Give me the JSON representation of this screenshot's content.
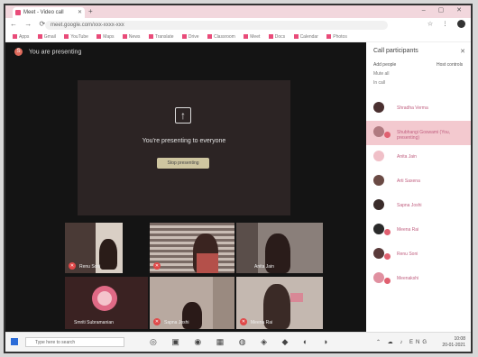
{
  "browser": {
    "tab_title": "Meet - Video call",
    "new_tab": "+",
    "window_controls": "– ▢ ✕",
    "url": "meet.google.com/xxx-xxxx-xxx",
    "nav": "← → ⟳",
    "addr_icons": "☆ ⋮",
    "bookmarks": [
      "Apps",
      "Gmail",
      "YouTube",
      "Maps",
      "News",
      "Translate",
      "Drive",
      "Classroom",
      "Meet",
      "Docs",
      "Calendar",
      "Photos"
    ]
  },
  "meet": {
    "present_label": "You are presenting",
    "present_initial": "S",
    "stage_message": "You're presenting to everyone",
    "stop_button": "Stop presenting",
    "tiles": [
      {
        "name": "Renu Soni"
      },
      {
        "name": ""
      },
      {
        "name": "Anita Jain"
      },
      {
        "name": "Smriti Subramanian"
      },
      {
        "name": "Sapna Joshi"
      },
      {
        "name": "Meena Rai"
      }
    ]
  },
  "sidebar": {
    "title": "Call participants",
    "close": "✕",
    "action_add": "Add people",
    "action_host": "Host controls",
    "sub1": "Mute all",
    "sub2": "In call",
    "participants": [
      {
        "name": "Shradha Verma"
      },
      {
        "name": "Shubhangi Goswami (You, presenting)"
      },
      {
        "name": "Anita Jain"
      },
      {
        "name": "Arti Saxena"
      },
      {
        "name": "Sapna Joshi"
      },
      {
        "name": "Meena Rai"
      },
      {
        "name": "Renu Soni"
      },
      {
        "name": "Meenakshi"
      }
    ]
  },
  "taskbar": {
    "search_placeholder": "Type here to search",
    "apps": "◎ ▣ ◉ ▦ ◍ ◈ ◆ ◐ ◑",
    "tray_icons": "⌃ ☁ ♪ ENG",
    "time": "10:08",
    "date": "20-01-2021"
  },
  "colors": {
    "accent": "#e94b79",
    "mic_off": "#e04848",
    "highlight": "#f3c9cf"
  }
}
